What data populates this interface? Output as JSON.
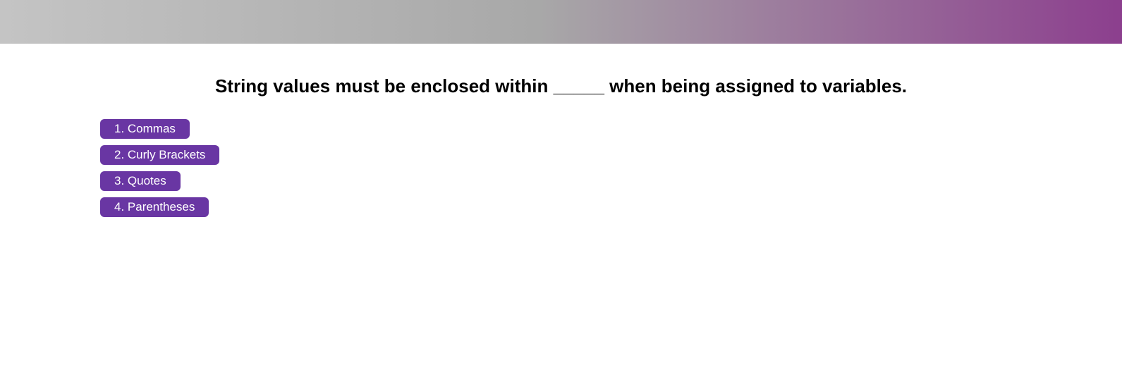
{
  "colors": {
    "banner_start": "#c4c4c4",
    "banner_mid": "#a8a8a8",
    "banner_end": "#8c3f8e",
    "button_bg": "#6936a3",
    "button_text": "#ffffff",
    "title_text": "#000000"
  },
  "quiz": {
    "question": "String values must be enclosed within _____ when being assigned to variables.",
    "answers": [
      {
        "label": "1. Commas"
      },
      {
        "label": "2. Curly Brackets"
      },
      {
        "label": "3. Quotes"
      },
      {
        "label": "4. Parentheses"
      }
    ]
  }
}
